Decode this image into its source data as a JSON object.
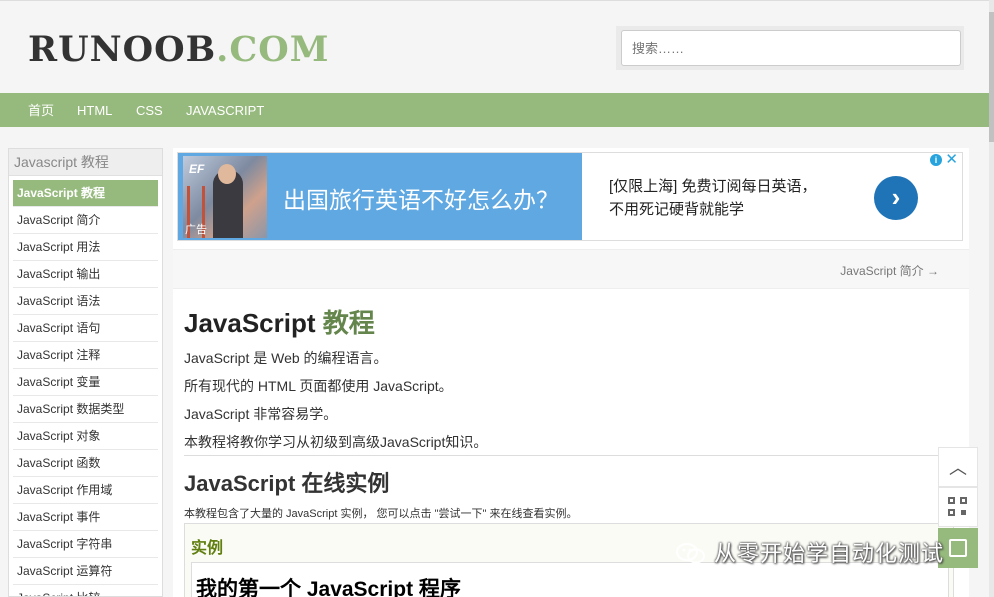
{
  "header": {
    "logo_main": "RUNOOB",
    "logo_tld": ".COM",
    "search_placeholder": "搜索……"
  },
  "nav": {
    "items": [
      "首页",
      "HTML",
      "CSS",
      "JAVASCRIPT"
    ]
  },
  "sidebar": {
    "heading": "Javascript 教程",
    "items": [
      "JavaScript 教程",
      "JavaScript 简介",
      "JavaScript 用法",
      "JavaScript 输出",
      "JavaScript 语法",
      "JavaScript 语句",
      "JavaScript 注释",
      "JavaScript 变量",
      "JavaScript 数据类型",
      "JavaScript 对象",
      "JavaScript 函数",
      "JavaScript 作用域",
      "JavaScript 事件",
      "JavaScript 字符串",
      "JavaScript 运算符",
      "JavaScript 比较"
    ],
    "active_index": 0
  },
  "ad": {
    "brand": "EF",
    "label": "广告",
    "headline": "出国旅行英语不好怎么办？",
    "description": "[仅限上海] 免费订阅每日英语，不用死记硬背就能学",
    "arrow": "›",
    "info_glyph": "i",
    "close_glyph": "✕"
  },
  "nav_next": "JavaScript 简介 →",
  "article": {
    "title_plain": "JavaScript ",
    "title_highlight": "教程",
    "paragraphs": [
      "JavaScript 是 Web 的编程语言。",
      "所有现代的 HTML 页面都使用 JavaScript。",
      "JavaScript 非常容易学。",
      "本教程将教你学习从初级到高级JavaScript知识。"
    ],
    "section_title": "JavaScript 在线实例",
    "section_desc": "本教程包含了大量的 JavaScript 实例， 您可以点击 \"尝试一下\" 来在线查看实例。",
    "example_label": "实例",
    "example_code_title": "我的第一个 JavaScript 程序"
  },
  "float_buttons": {
    "top_glyph": "︿"
  },
  "watermark": "从零开始学自动化测试",
  "colors": {
    "brand_green": "#96b97d",
    "dark_green": "#64854c",
    "ad_blue": "#5fa8e2",
    "ad_button": "#1f74b7"
  }
}
